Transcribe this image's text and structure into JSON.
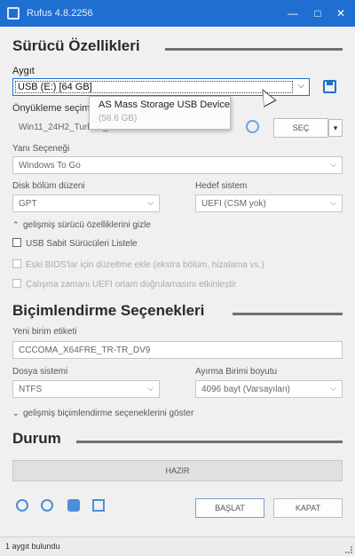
{
  "window": {
    "title": "Rufus 4.8.2256",
    "minimize": "—",
    "maximize": "□",
    "close": "✕"
  },
  "drive": {
    "section_title": "Sürücü Özellikleri",
    "device_label": "Aygıt",
    "device_value": "USB (E:) [64 GB]",
    "boot_selection_label": "Önyükleme seçimi",
    "boot_selection_value": "Win11_24H2_Turkish_x64.iso",
    "select_button": "SEÇ",
    "image_option_label": "Yanı Seçeneği",
    "image_option_value": "Windows To Go",
    "partition_scheme_label": "Disk bölüm düzeni",
    "partition_scheme_value": "GPT",
    "target_system_label": "Hedef sistem",
    "target_system_value": "UEFI (CSM yok)",
    "advanced_drive_toggle": "gelişmiş sürücü özelliklerini gizle",
    "list_usb_hdd": "USB Sabit Sürücüleri Listele",
    "old_bios_fixes": "Eski BIOS'lar için düzeltme ekle (ekstra bölüm, hizalama vs.)",
    "runtime_uefi_check": "Çalışma zamanı UEFI ortam doğrulamasını etkinleştir"
  },
  "tooltip": {
    "line1": "AS Mass Storage USB Device",
    "line2": "(58.6 GB)"
  },
  "format": {
    "section_title": "Biçimlendirme Seçenekleri",
    "volume_label_label": "Yeni birim etiketi",
    "volume_label_value": "CCCOMA_X64FRE_TR-TR_DV9",
    "filesystem_label": "Dosya sistemi",
    "filesystem_value": "NTFS",
    "cluster_size_label": "Ayırma Birimi boyutu",
    "cluster_size_value": "4096 bayt (Varsayılan)",
    "advanced_format_toggle": "gelişmiş biçimlendirme seçeneklerini göster"
  },
  "status": {
    "section_title": "Durum",
    "progress_text": "HAZIR",
    "progress_fraction": 0
  },
  "actions": {
    "start_button": "BAŞLAT",
    "close_button": "KAPAT"
  },
  "statusbar": {
    "text": "1 aygıt bulundu"
  },
  "colors": {
    "title_bar": "#1f6fd1",
    "accent": "#4a8fd8"
  }
}
